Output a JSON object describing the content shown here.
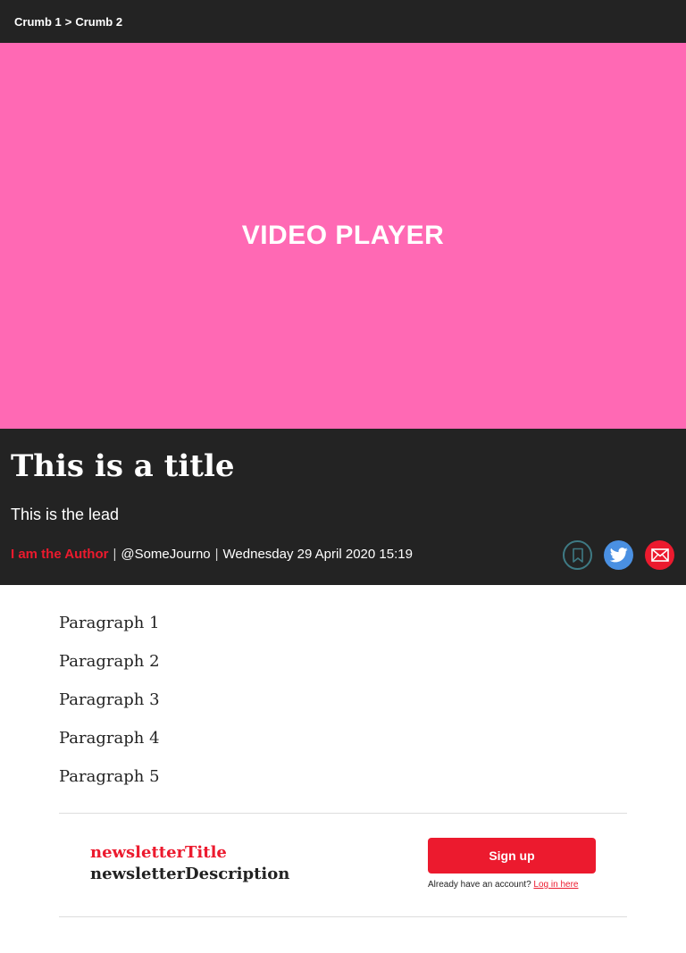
{
  "breadcrumb": {
    "items": [
      "Crumb 1",
      "Crumb 2"
    ],
    "separator": ">"
  },
  "video": {
    "label": "VIDEO PLAYER",
    "background": "#ff69b4"
  },
  "article": {
    "title": "This is a title",
    "lead": "This is the lead",
    "author": "I am the Author",
    "handle": "@SomeJourno",
    "date": "Wednesday 29 April 2020 15:19",
    "paragraphs": [
      "Paragraph 1",
      "Paragraph 2",
      "Paragraph 3",
      "Paragraph 4",
      "Paragraph 5"
    ]
  },
  "share": {
    "icons": [
      "bookmark-icon",
      "twitter-icon",
      "email-icon"
    ]
  },
  "newsletter": {
    "title": "newsletterTitle",
    "description": "newsletterDescription",
    "signup_label": "Sign up",
    "account_prompt": "Already have an account?",
    "login_link": "Log in here"
  },
  "colors": {
    "header_bg": "#232323",
    "accent_red": "#ec1a2e",
    "twitter_blue": "#4a90e2",
    "bookmark_teal": "#3e7a84"
  }
}
